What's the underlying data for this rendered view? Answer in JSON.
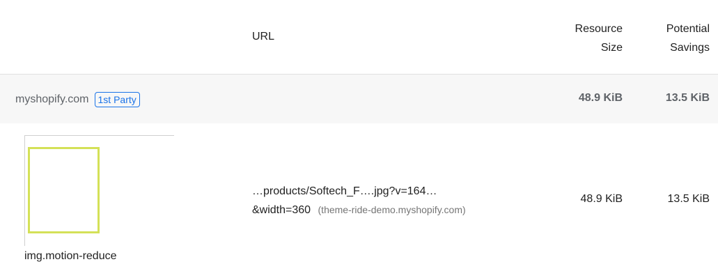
{
  "table": {
    "headers": {
      "url": "URL",
      "resource_size_line1": "Resource",
      "resource_size_line2": "Size",
      "potential_savings_line1": "Potential",
      "potential_savings_line2": "Savings"
    },
    "group": {
      "entity": "myshopify.com",
      "badge": "1st Party",
      "resource_size": "48.9 KiB",
      "potential_savings": "13.5 KiB"
    },
    "items": [
      {
        "selector": "img.motion-reduce",
        "url_line1": "…products/Softech_F….jpg?v=164…",
        "url_line2": "&width=360",
        "origin": "(theme-ride-demo.myshopify.com)",
        "resource_size": "48.9 KiB",
        "potential_savings": "13.5 KiB"
      }
    ]
  },
  "colors": {
    "highlight_box": "#d4e157",
    "badge": "#1a73e8"
  }
}
